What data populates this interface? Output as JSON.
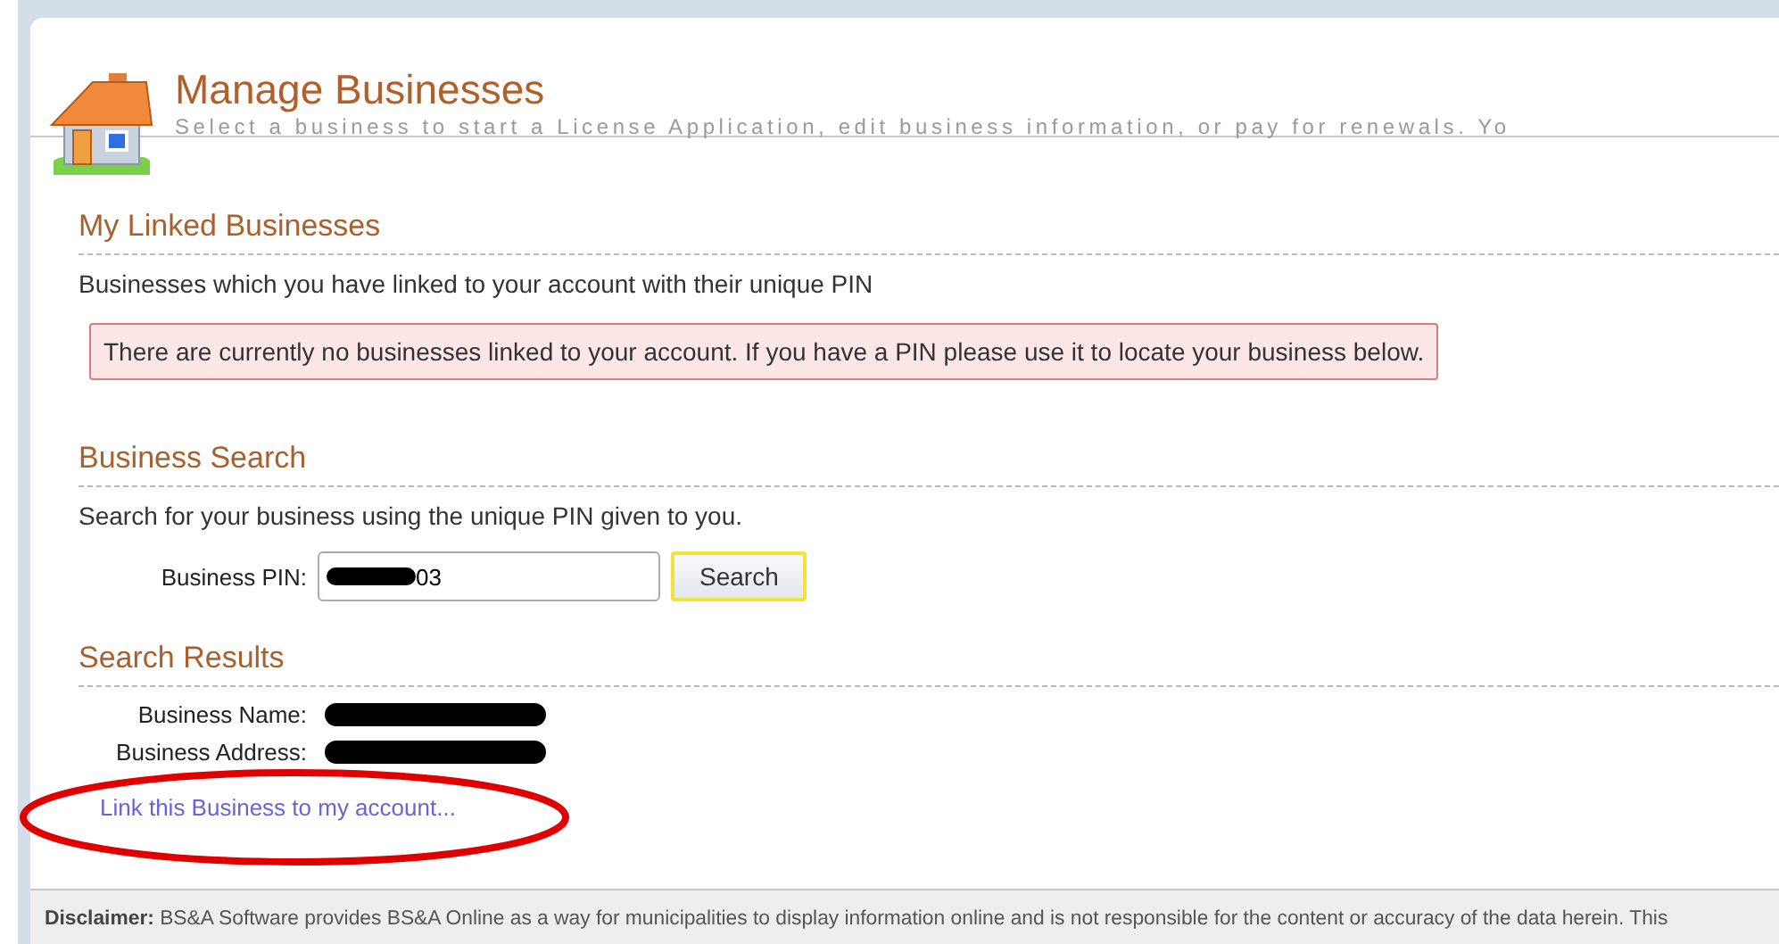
{
  "header": {
    "title": "Manage Businesses",
    "subtitle": "Select a business to start a License Application, edit business information, or pay for renewals. Yo"
  },
  "sections": [
    {
      "heading": "My Linked Businesses",
      "description": "Businesses which you have linked to your account with their unique PIN",
      "alert": "There are currently no businesses linked to your account. If you have a PIN please use it to locate your business below."
    },
    {
      "heading": "Business Search",
      "description": "Search for your business using the unique PIN given to you.",
      "field": {
        "label": "Business PIN:",
        "value": "03",
        "redacted": true
      },
      "button": {
        "label": "Search",
        "focused": true
      }
    },
    {
      "heading": "Search Results",
      "details": [
        {
          "label": "Business Name:",
          "redacted": true
        },
        {
          "label": "Business Address:",
          "redacted": true
        }
      ],
      "link": {
        "label": "Link this Business to my account...",
        "circled": true
      }
    }
  ],
  "footer": {
    "disclaimer": "**Disclaimer:** BS&A Software provides BS&A Online as a way for municipalities to display information online and is not responsible for the content or accuracy of the data herein. This"
  }
}
